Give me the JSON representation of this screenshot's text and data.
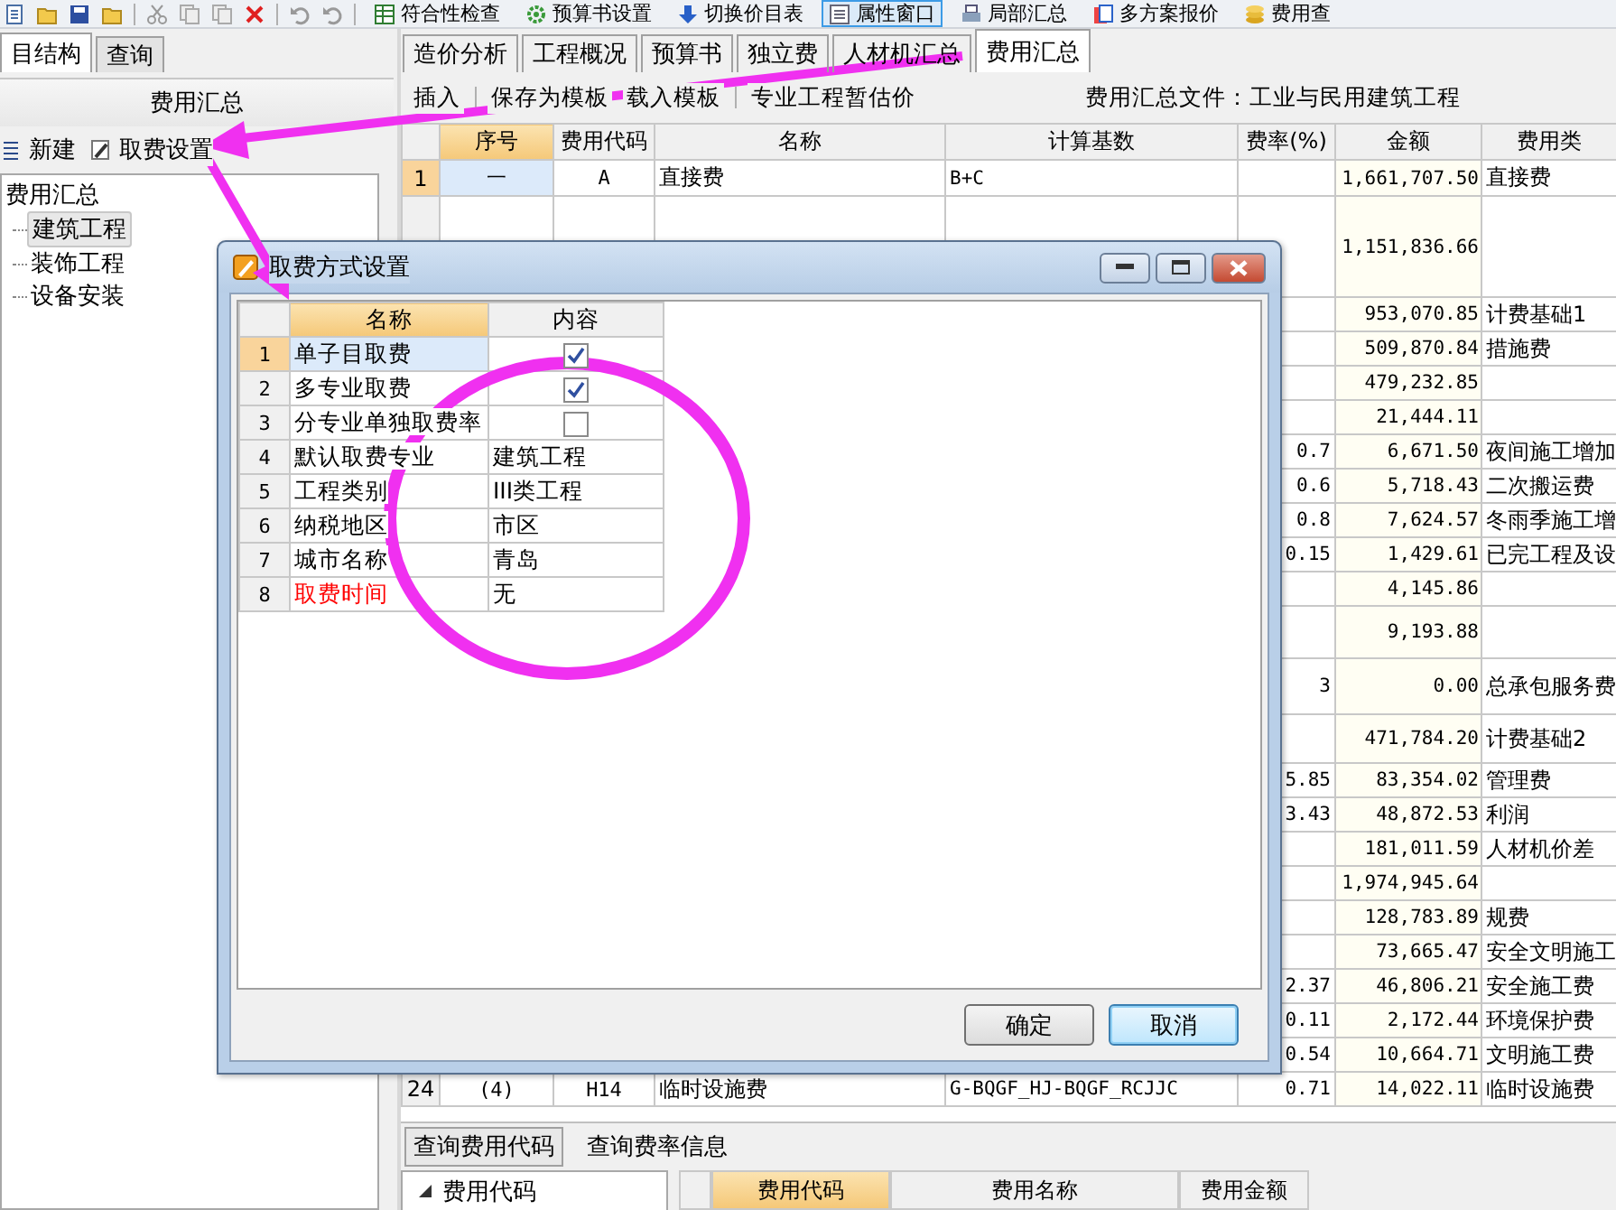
{
  "toolbar": {
    "items": [
      {
        "label": "符合性检查",
        "pressed": false
      },
      {
        "label": "预算书设置",
        "pressed": false
      },
      {
        "label": "切换价目表",
        "pressed": false
      },
      {
        "label": "属性窗口",
        "pressed": true
      },
      {
        "label": "局部汇总",
        "pressed": false
      },
      {
        "label": "多方案报价",
        "pressed": false
      },
      {
        "label": "费用查",
        "pressed": false
      }
    ]
  },
  "left_panel": {
    "tabs": [
      {
        "label": "目结构",
        "selected": true
      },
      {
        "label": "查询",
        "selected": false
      }
    ],
    "header": "费用汇总",
    "actions": [
      "新建",
      "取费设置"
    ],
    "tree": {
      "label": "费用汇总",
      "children": [
        {
          "label": "建筑工程",
          "selected": true
        },
        {
          "label": "装饰工程",
          "selected": false
        },
        {
          "label": "设备安装",
          "selected": false
        }
      ]
    }
  },
  "main": {
    "tabs": [
      {
        "label": "造价分析",
        "selected": false
      },
      {
        "label": "工程概况",
        "selected": false
      },
      {
        "label": "预算书",
        "selected": false
      },
      {
        "label": "独立费",
        "selected": false
      },
      {
        "label": "人材机汇总",
        "selected": false
      },
      {
        "label": "费用汇总",
        "selected": true
      }
    ],
    "toolbar": [
      "插入",
      "保存为模板",
      "载入模板",
      "专业工程暂估价"
    ],
    "summary_file": "费用汇总文件：工业与民用建筑工程",
    "table": {
      "columns": [
        {
          "label": "序号",
          "selected": true
        },
        {
          "label": "费用代码",
          "selected": false
        },
        {
          "label": "名称",
          "selected": false
        },
        {
          "label": "计算基数",
          "selected": false
        },
        {
          "label": "费率(%)",
          "selected": false
        },
        {
          "label": "金额",
          "selected": false
        },
        {
          "label": "费用类",
          "selected": false
        }
      ],
      "rows": [
        {
          "num": "1",
          "seq": "一",
          "code": "A",
          "name": "直接费",
          "base": "B+C",
          "amount": "1,661,707.50",
          "category": "直接费",
          "selected": true
        },
        {
          "amount": "1,151,836.66"
        },
        {
          "amount": "953,070.85",
          "category": "计费基础1"
        },
        {
          "amount": "509,870.84",
          "category": "措施费"
        },
        {
          "amount": "479,232.85"
        },
        {
          "amount": "21,444.11"
        },
        {
          "rate": "0.7",
          "amount": "6,671.50",
          "category": "夜间施工增加"
        },
        {
          "rate": "0.6",
          "amount": "5,718.43",
          "category": "二次搬运费"
        },
        {
          "rate": "0.8",
          "amount": "7,624.57",
          "category": "冬雨季施工增"
        },
        {
          "rate": "0.15",
          "amount": "1,429.61",
          "category": "已完工程及设"
        },
        {
          "amount": "4,145.86"
        },
        {
          "amount": "9,193.88"
        },
        {
          "rate": "3",
          "amount": "0.00",
          "category": "总承包服务费"
        },
        {
          "amount": "471,784.20",
          "category": "计费基础2"
        },
        {
          "rate": "5.85",
          "amount": "83,354.02",
          "category": "管理费"
        },
        {
          "rate": "3.43",
          "amount": "48,872.53",
          "category": "利润"
        },
        {
          "amount": "181,011.59",
          "category": "人材机价差"
        },
        {
          "amount": "1,974,945.64"
        },
        {
          "amount": "128,783.89",
          "category": "规费"
        },
        {
          "amount": "73,665.47",
          "category": "安全文明施工"
        },
        {
          "rate": "2.37",
          "amount": "46,806.21",
          "category": "安全施工费"
        },
        {
          "rate": "0.11",
          "amount": "2,172.44",
          "category": "环境保护费"
        },
        {
          "rate": "0.54",
          "amount": "10,664.71",
          "category": "文明施工费"
        },
        {
          "num": "24",
          "seq": "(4)",
          "code": "H14",
          "name": "临时设施费",
          "base": "G-BQGF_HJ-BQGF_RCJJC",
          "rate": "0.71",
          "amount": "14,022.11",
          "category": "临时设施费",
          "selected": false
        }
      ]
    }
  },
  "dialog": {
    "title": "取费方式设置",
    "columns": [
      {
        "label": "名称",
        "selected": true
      },
      {
        "label": "内容",
        "selected": false
      }
    ],
    "rows": [
      {
        "num": "1",
        "name": "单子目取费",
        "kind": "checkbox",
        "checked": true,
        "selected": true,
        "warning": false
      },
      {
        "num": "2",
        "name": "多专业取费",
        "kind": "checkbox",
        "checked": true,
        "selected": false,
        "warning": false
      },
      {
        "num": "3",
        "name": "分专业单独取费率",
        "kind": "checkbox",
        "checked": false,
        "selected": false,
        "warning": false
      },
      {
        "num": "4",
        "name": "默认取费专业",
        "kind": "text",
        "value": "建筑工程",
        "selected": false,
        "warning": false
      },
      {
        "num": "5",
        "name": "工程类别",
        "kind": "text",
        "value": "III类工程",
        "selected": false,
        "warning": false
      },
      {
        "num": "6",
        "name": "纳税地区",
        "kind": "text",
        "value": "市区",
        "selected": false,
        "warning": false
      },
      {
        "num": "7",
        "name": "城市名称",
        "kind": "text",
        "value": "青岛",
        "selected": false,
        "warning": false
      },
      {
        "num": "8",
        "name": "取费时间",
        "kind": "text",
        "value": "无",
        "selected": false,
        "warning": true
      }
    ],
    "buttons": [
      {
        "label": "确定",
        "focused": false
      },
      {
        "label": "取消",
        "focused": true
      }
    ]
  },
  "bottom_panel": {
    "tabs": [
      {
        "label": "查询费用代码",
        "selected": true
      },
      {
        "label": "查询费率信息",
        "selected": false
      }
    ],
    "tree": {
      "label": "费用代码",
      "expanded": true
    },
    "columns": [
      {
        "label": "费用代码",
        "selected": true
      },
      {
        "label": "费用名称",
        "selected": false
      },
      {
        "label": "费用金额",
        "selected": false
      }
    ]
  }
}
